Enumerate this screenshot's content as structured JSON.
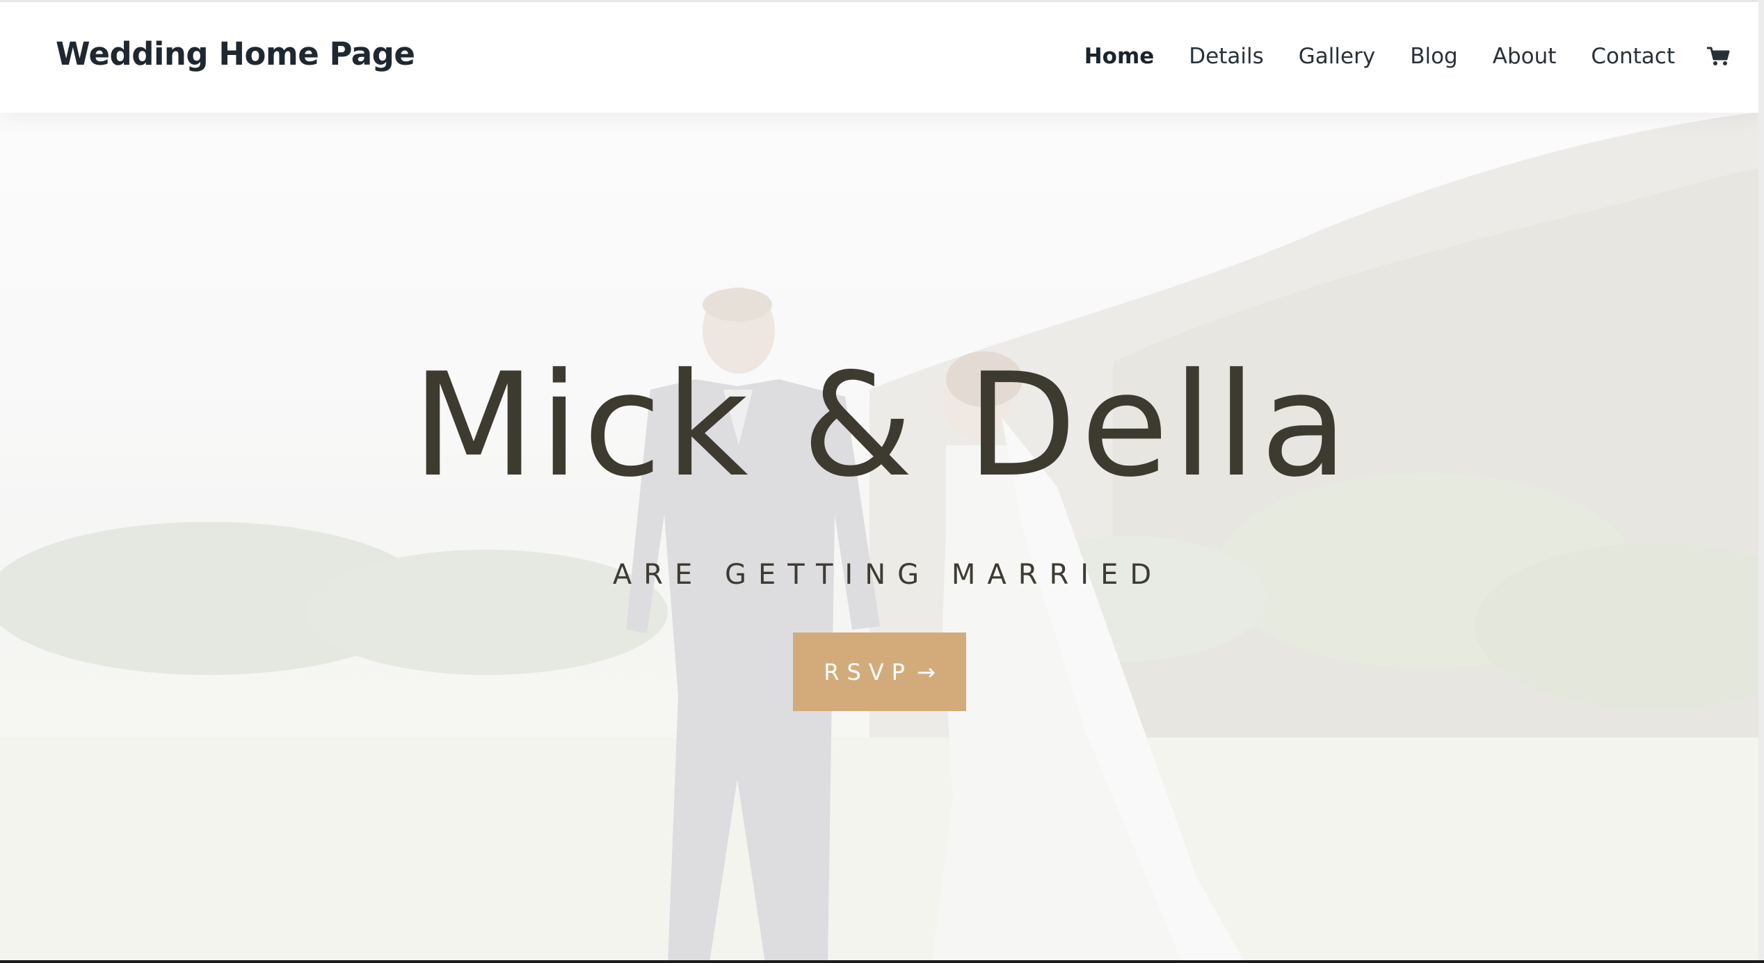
{
  "header": {
    "site_title": "Wedding Home Page",
    "nav": [
      {
        "label": "Home",
        "active": true
      },
      {
        "label": "Details",
        "active": false
      },
      {
        "label": "Gallery",
        "active": false
      },
      {
        "label": "Blog",
        "active": false
      },
      {
        "label": "About",
        "active": false
      },
      {
        "label": "Contact",
        "active": false
      }
    ],
    "cart_icon": "shopping-cart-icon"
  },
  "hero": {
    "headline": "Mick & Della",
    "subheadline": "ARE GETTING MARRIED",
    "button_label": "RSVP",
    "button_arrow": "→",
    "button_color": "#d3ab7b",
    "text_color": "#3d3a2f"
  }
}
